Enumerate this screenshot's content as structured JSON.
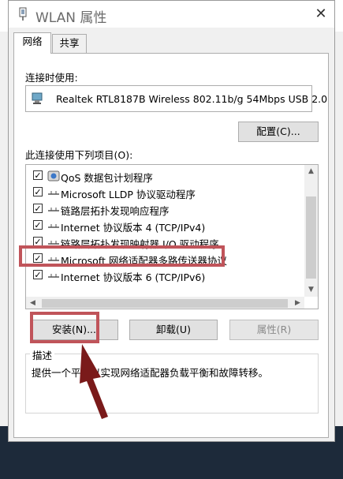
{
  "window": {
    "title": "WLAN 属性"
  },
  "tabs": [
    {
      "label": "网络"
    },
    {
      "label": "共享"
    }
  ],
  "connect_using": {
    "label": "连接时使用:",
    "adapter": "Realtek RTL8187B Wireless 802.11b/g 54Mbps USB 2.0",
    "configure_button": "配置(C)..."
  },
  "items_label": "此连接使用下列项目(O):",
  "items": [
    {
      "label": "QoS 数据包计划程序",
      "checked": true,
      "icon": "qos-icon"
    },
    {
      "label": "Microsoft LLDP 协议驱动程序",
      "checked": true,
      "icon": "protocol-icon"
    },
    {
      "label": "链路层拓扑发现响应程序",
      "checked": true,
      "icon": "protocol-icon"
    },
    {
      "label": "Internet 协议版本 4 (TCP/IPv4)",
      "checked": true,
      "icon": "protocol-icon"
    },
    {
      "label": "链路层拓扑发现映射器 I/O 驱动程序",
      "checked": true,
      "icon": "protocol-icon"
    },
    {
      "label": "Microsoft 网络适配器多路传送器协议",
      "checked": true,
      "icon": "protocol-icon"
    },
    {
      "label": "Internet 协议版本 6 (TCP/IPv6)",
      "checked": true,
      "icon": "protocol-icon"
    }
  ],
  "buttons": {
    "install": "安装(N)...",
    "uninstall": "卸载(U)",
    "properties": "属性(R)"
  },
  "description": {
    "label": "描述",
    "text": "提供一个平台以实现网络适配器负载平衡和故障转移。"
  },
  "annotation_color": "#c0545a"
}
